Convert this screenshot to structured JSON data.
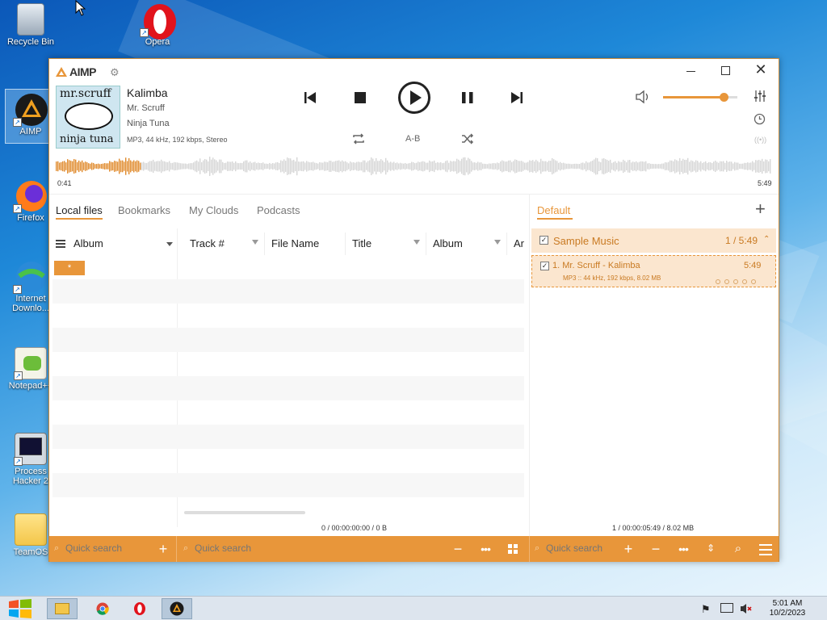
{
  "desktop": {
    "icons": [
      {
        "label": "Recycle Bin",
        "icon": "recycle-bin-icon"
      },
      {
        "label": "Opera",
        "icon": "opera-icon"
      },
      {
        "label": "AIMP",
        "icon": "aimp-icon"
      },
      {
        "label": "Firefox",
        "icon": "firefox-icon"
      },
      {
        "label": "Internet Downlo...",
        "icon": "idm-icon"
      },
      {
        "label": "Notepad++",
        "icon": "notepadpp-icon"
      },
      {
        "label": "Process Hacker 2",
        "icon": "process-hacker-icon"
      },
      {
        "label": "TeamOS",
        "icon": "folder-icon"
      }
    ]
  },
  "player": {
    "logo": "AIMP",
    "track": {
      "title": "Kalimba",
      "artist": "Mr. Scruff",
      "album": "Ninja Tuna",
      "info": "MP3, 44 kHz, 192 kbps, Stereo",
      "cover_top": "mr.scruff",
      "cover_bottom": "ninja tuna"
    },
    "ab_label": "A-B",
    "elapsed": "0:41",
    "duration": "5:49",
    "progress": 0.118,
    "volume": 0.82
  },
  "library": {
    "tabs": [
      "Local files",
      "Bookmarks",
      "My Clouds",
      "Podcasts"
    ],
    "active_tab": "Local files",
    "group_label": "Album",
    "group_item": "*",
    "columns": [
      "Track #",
      "File Name",
      "Title",
      "Album",
      "Ar"
    ],
    "status": "0 / 00:00:00:00 / 0 B"
  },
  "playlist": {
    "tab": "Default",
    "group_name": "Sample Music",
    "group_stats": "1 / 5:49",
    "item_title": "1. Mr. Scruff - Kalimba",
    "item_duration": "5:49",
    "item_info": "MP3 :: 44 kHz, 192 kbps, 8.02 MB",
    "rating": 0,
    "status": "1 / 00:00:05:49 / 8.02 MB"
  },
  "search": {
    "library_groups_placeholder": "Quick search",
    "library_placeholder": "Quick search",
    "playlist_placeholder": "Quick search"
  },
  "taskbar": {
    "time": "5:01 AM",
    "date": "10/2/2023"
  },
  "colors": {
    "accent": "#e8963a",
    "accent_light": "#fbe6cf",
    "waveform_played": "#e08a2c",
    "waveform_unplayed": "#d6d6d6"
  }
}
